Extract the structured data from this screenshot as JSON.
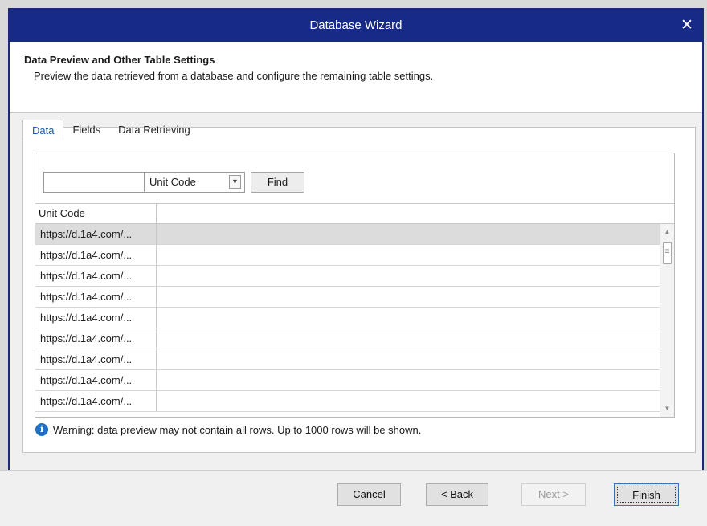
{
  "window": {
    "title": "Database Wizard",
    "close_glyph": "✕"
  },
  "header": {
    "title": "Data Preview and Other Table Settings",
    "subtitle": "Preview the data retrieved from a database and configure the remaining table settings."
  },
  "tabs": [
    {
      "label": "Data",
      "active": true
    },
    {
      "label": "Fields",
      "active": false
    },
    {
      "label": "Data Retrieving",
      "active": false
    }
  ],
  "search": {
    "input_value": "",
    "field_select": "Unit Code",
    "find_label": "Find"
  },
  "grid": {
    "column_header": "Unit Code",
    "rows": [
      "https://d.1a4.com/...",
      "https://d.1a4.com/...",
      "https://d.1a4.com/...",
      "https://d.1a4.com/...",
      "https://d.1a4.com/...",
      "https://d.1a4.com/...",
      "https://d.1a4.com/...",
      "https://d.1a4.com/...",
      "https://d.1a4.com/..."
    ],
    "selected_row": 0
  },
  "warning": {
    "icon": "info-icon",
    "text": "Warning: data preview may not contain all rows. Up to 1000 rows will be shown."
  },
  "buttons": {
    "cancel": "Cancel",
    "back": "< Back",
    "next": "Next >",
    "finish": "Finish"
  },
  "colors": {
    "titlebar": "#162a86",
    "active_tab_text": "#1a56b0",
    "info_icon": "#1f6fc5"
  }
}
